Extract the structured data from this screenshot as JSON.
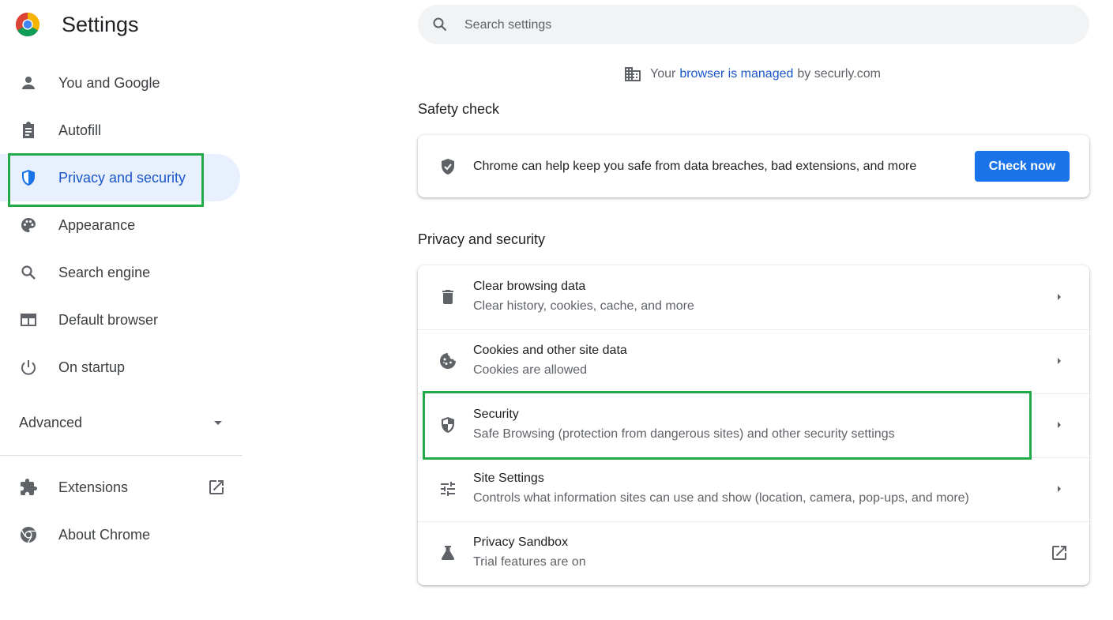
{
  "app": {
    "title": "Settings"
  },
  "sidebar": {
    "items": [
      {
        "label": "You and Google",
        "icon": "person-icon"
      },
      {
        "label": "Autofill",
        "icon": "clipboard-icon"
      },
      {
        "label": "Privacy and security",
        "icon": "shield-icon",
        "active": true
      },
      {
        "label": "Appearance",
        "icon": "palette-icon"
      },
      {
        "label": "Search engine",
        "icon": "search-icon"
      },
      {
        "label": "Default browser",
        "icon": "browser-window-icon"
      },
      {
        "label": "On startup",
        "icon": "power-icon"
      }
    ],
    "advanced_label": "Advanced",
    "bottom_items": [
      {
        "label": "Extensions",
        "icon": "puzzle-icon"
      },
      {
        "label": "About Chrome",
        "icon": "chrome-icon"
      }
    ]
  },
  "search": {
    "placeholder": "Search settings"
  },
  "managed": {
    "prefix": "Your",
    "link": "browser is managed",
    "suffix": "by securly.com"
  },
  "safety_check": {
    "title": "Safety check",
    "text": "Chrome can help keep you safe from data breaches, bad extensions, and more",
    "button": "Check now"
  },
  "privacy": {
    "title": "Privacy and security",
    "rows": [
      {
        "title": "Clear browsing data",
        "subtitle": "Clear history, cookies, cache, and more",
        "icon": "trash-icon"
      },
      {
        "title": "Cookies and other site data",
        "subtitle": "Cookies are allowed",
        "icon": "cookie-icon"
      },
      {
        "title": "Security",
        "subtitle": "Safe Browsing (protection from dangerous sites) and other security settings",
        "icon": "security-shield-icon"
      },
      {
        "title": "Site Settings",
        "subtitle": "Controls what information sites can use and show (location, camera, pop-ups, and more)",
        "icon": "tune-icon"
      },
      {
        "title": "Privacy Sandbox",
        "subtitle": "Trial features are on",
        "icon": "flask-icon"
      }
    ]
  },
  "colors": {
    "accent": "#1a73e8",
    "active_bg": "#e8f0fe",
    "highlight": "#22a94a"
  }
}
